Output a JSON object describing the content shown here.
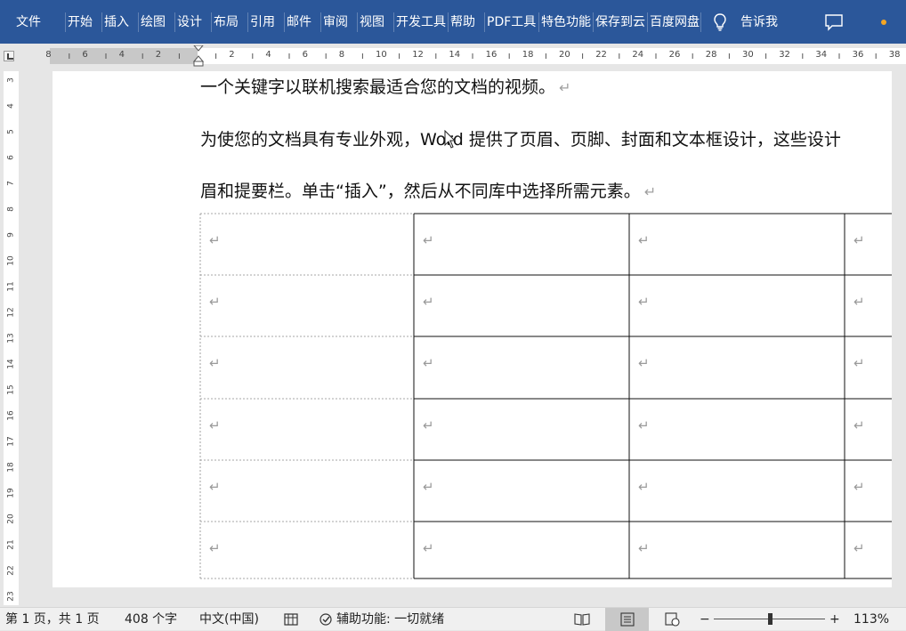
{
  "ribbon": {
    "tabs": [
      "文件",
      "开始",
      "插入",
      "绘图",
      "设计",
      "布局",
      "引用",
      "邮件",
      "审阅",
      "视图",
      "开发工具",
      "帮助",
      "PDF工具",
      "特色功能",
      "保存到云",
      "百度网盘"
    ],
    "tell_me": "告诉我",
    "bg_color": "#2b579a"
  },
  "ruler": {
    "h_numbers": [
      "8",
      "6",
      "4",
      "2",
      "",
      "2",
      "4",
      "6",
      "8",
      "10",
      "12",
      "14",
      "16",
      "18",
      "20",
      "22",
      "24",
      "26",
      "28",
      "30",
      "32",
      "34",
      "36",
      "38"
    ],
    "v_numbers": [
      "3",
      "4",
      "5",
      "6",
      "7",
      "8",
      "9",
      "10",
      "11",
      "12",
      "13",
      "14",
      "15",
      "16",
      "17",
      "18",
      "19",
      "20",
      "21",
      "22",
      "23"
    ]
  },
  "document": {
    "paragraphs": [
      "一个关键字以联机搜索最适合您的文档的视频。",
      "为使您的文档具有专业外观，Word 提供了页眉、页脚、封面和文本框设计，这些设计",
      "眉和提要栏。单击“插入”，然后从不同库中选择所需元素。"
    ],
    "paragraph_mark": "↵",
    "table": {
      "rows": 6,
      "cols": 4
    }
  },
  "status": {
    "page": "第 1 页，共 1 页",
    "words": "408 个字",
    "language": "中文(中国)",
    "accessibility": "辅助功能: 一切就绪",
    "zoom_minus": "−",
    "zoom_plus": "+",
    "zoom": "113%"
  }
}
